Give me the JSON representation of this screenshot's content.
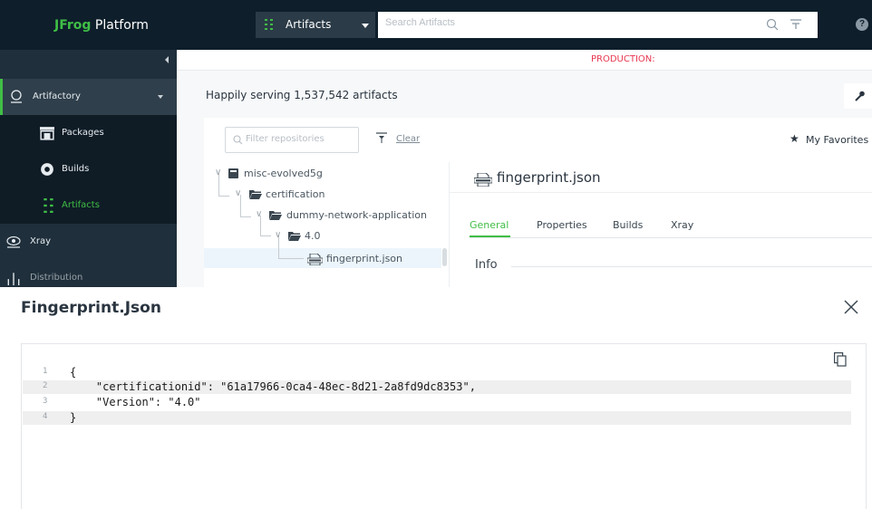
{
  "header": {
    "brand": "JFrog",
    "product": " Platform",
    "package_selector": "Artifacts",
    "search_placeholder": "Search Artifacts",
    "help_glyph": "?"
  },
  "sidebar": {
    "items": [
      {
        "label": "Artifactory",
        "icon": "artifactory-icon"
      },
      {
        "label": "Packages",
        "icon": "packages-icon"
      },
      {
        "label": "Builds",
        "icon": "builds-icon"
      },
      {
        "label": "Artifacts",
        "icon": "artifacts-grid-icon"
      },
      {
        "label": "Xray",
        "icon": "eye-icon"
      },
      {
        "label": "Distribution",
        "icon": "distribution-icon"
      }
    ]
  },
  "environment": "PRODUCTION:",
  "content": {
    "happily": "Happily serving 1,537,542 artifacts",
    "filter_placeholder": "Filter repositories",
    "clear": "Clear",
    "favorites": "My Favorites"
  },
  "tree": {
    "nodes": [
      {
        "label": "misc-evolved5g",
        "icon": "repo-icon"
      },
      {
        "label": "certification",
        "icon": "folder-open-icon"
      },
      {
        "label": "dummy-network-application",
        "icon": "folder-open-icon"
      },
      {
        "label": "4.0",
        "icon": "folder-open-icon"
      },
      {
        "label": "fingerprint.json",
        "icon": "json-file-icon"
      }
    ]
  },
  "detail": {
    "title": "fingerprint.json",
    "tabs": [
      "General",
      "Properties",
      "Builds",
      "Xray"
    ],
    "active_tab": "General",
    "section": "Info"
  },
  "modal": {
    "title": "Fingerprint.Json",
    "code_lines": [
      {
        "n": "1",
        "text": "{"
      },
      {
        "n": "2",
        "text": "    \"certificationid\": \"61a17966-0ca4-48ec-8d21-2a8fd9dc8353\","
      },
      {
        "n": "3",
        "text": "    \"Version\": \"4.0\""
      },
      {
        "n": "4",
        "text": "}"
      }
    ]
  },
  "colors": {
    "accent": "#40be46",
    "topbar": "#0e1e2b",
    "sidebar": "#1f2f3b",
    "env": "#e8364f"
  }
}
